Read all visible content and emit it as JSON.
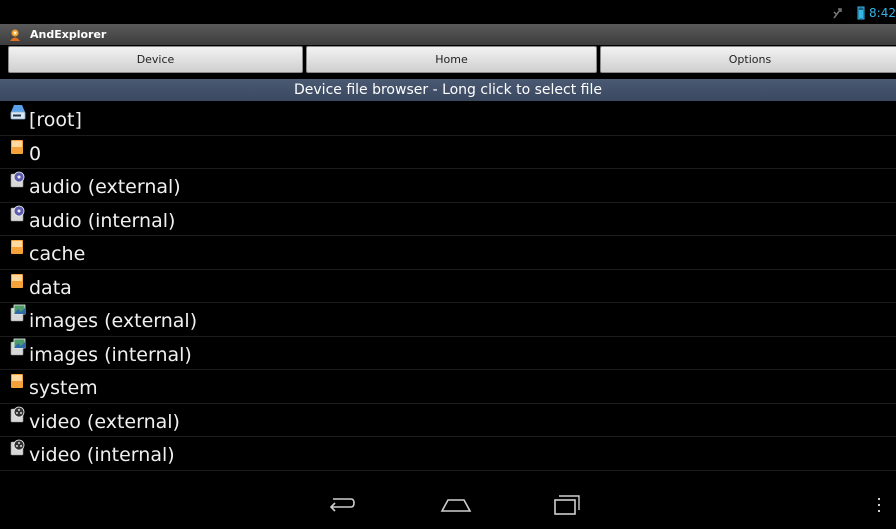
{
  "status_bar": {
    "time": "8:42"
  },
  "app": {
    "title": "AndExplorer"
  },
  "buttons": {
    "device": "Device",
    "home": "Home",
    "options": "Options"
  },
  "header": {
    "text": "Device file browser - Long click to select file"
  },
  "files": [
    {
      "label": "[root]",
      "icon": "drive-icon"
    },
    {
      "label": "0",
      "icon": "folder-icon"
    },
    {
      "label": "audio (external)",
      "icon": "audio-folder-icon"
    },
    {
      "label": "audio (internal)",
      "icon": "audio-folder-icon"
    },
    {
      "label": "cache",
      "icon": "folder-icon"
    },
    {
      "label": "data",
      "icon": "folder-icon"
    },
    {
      "label": "images (external)",
      "icon": "images-folder-icon"
    },
    {
      "label": "images (internal)",
      "icon": "images-folder-icon"
    },
    {
      "label": "system",
      "icon": "folder-icon"
    },
    {
      "label": "video (external)",
      "icon": "video-folder-icon"
    },
    {
      "label": "video (internal)",
      "icon": "video-folder-icon"
    }
  ],
  "colors": {
    "accent": "#33b5e5",
    "header_bg": "#3e4c64",
    "folder": "#f5a23a"
  }
}
